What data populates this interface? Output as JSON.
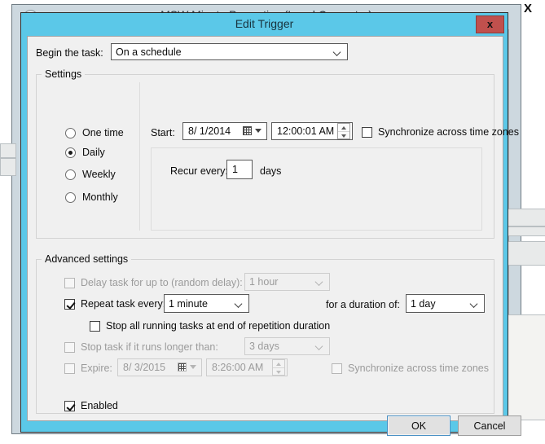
{
  "background_window": {
    "title": "MSW Minute Properties (Local Computer)",
    "close_label": "X",
    "icon": "clock-icon"
  },
  "dialog": {
    "title": "Edit Trigger",
    "close_label": "x",
    "begin_task": {
      "label": "Begin the task:",
      "value": "On a schedule"
    },
    "settings": {
      "legend": "Settings",
      "schedule_options": [
        {
          "label": "One time",
          "selected": false
        },
        {
          "label": "Daily",
          "selected": true
        },
        {
          "label": "Weekly",
          "selected": false
        },
        {
          "label": "Monthly",
          "selected": false
        }
      ],
      "start": {
        "label": "Start:",
        "date": "8/ 1/2014",
        "time": "12:00:01 AM"
      },
      "sync_time_zones": {
        "label": "Synchronize across time zones",
        "checked": false,
        "disabled": false
      },
      "recur": {
        "label": "Recur every:",
        "value": "1",
        "unit": "days"
      }
    },
    "advanced": {
      "legend": "Advanced settings",
      "delay": {
        "label": "Delay task for up to (random delay):",
        "checked": false,
        "value": "1 hour",
        "disabled": true
      },
      "repeat": {
        "label": "Repeat task every:",
        "checked": true,
        "value": "1 minute",
        "disabled": false,
        "duration_label": "for a duration of:",
        "duration_value": "1 day"
      },
      "stop_all": {
        "label": "Stop all running tasks at end of repetition duration",
        "checked": false,
        "disabled": false
      },
      "stop_longer": {
        "label": "Stop task if it runs longer than:",
        "checked": false,
        "value": "3 days",
        "disabled": true
      },
      "expire": {
        "label": "Expire:",
        "checked": false,
        "date": "8/ 3/2015",
        "time": "8:26:00 AM",
        "disabled": true
      },
      "expire_sync": {
        "label": "Synchronize across time zones",
        "checked": false,
        "disabled": true
      },
      "enabled": {
        "label": "Enabled",
        "checked": true
      }
    },
    "buttons": {
      "ok": "OK",
      "cancel": "Cancel"
    }
  },
  "colors": {
    "titlebar": "#5bc8e8",
    "close_button": "#c0504d",
    "dialog_bg": "#f0f0f0",
    "background_window": "#cdd8df"
  }
}
